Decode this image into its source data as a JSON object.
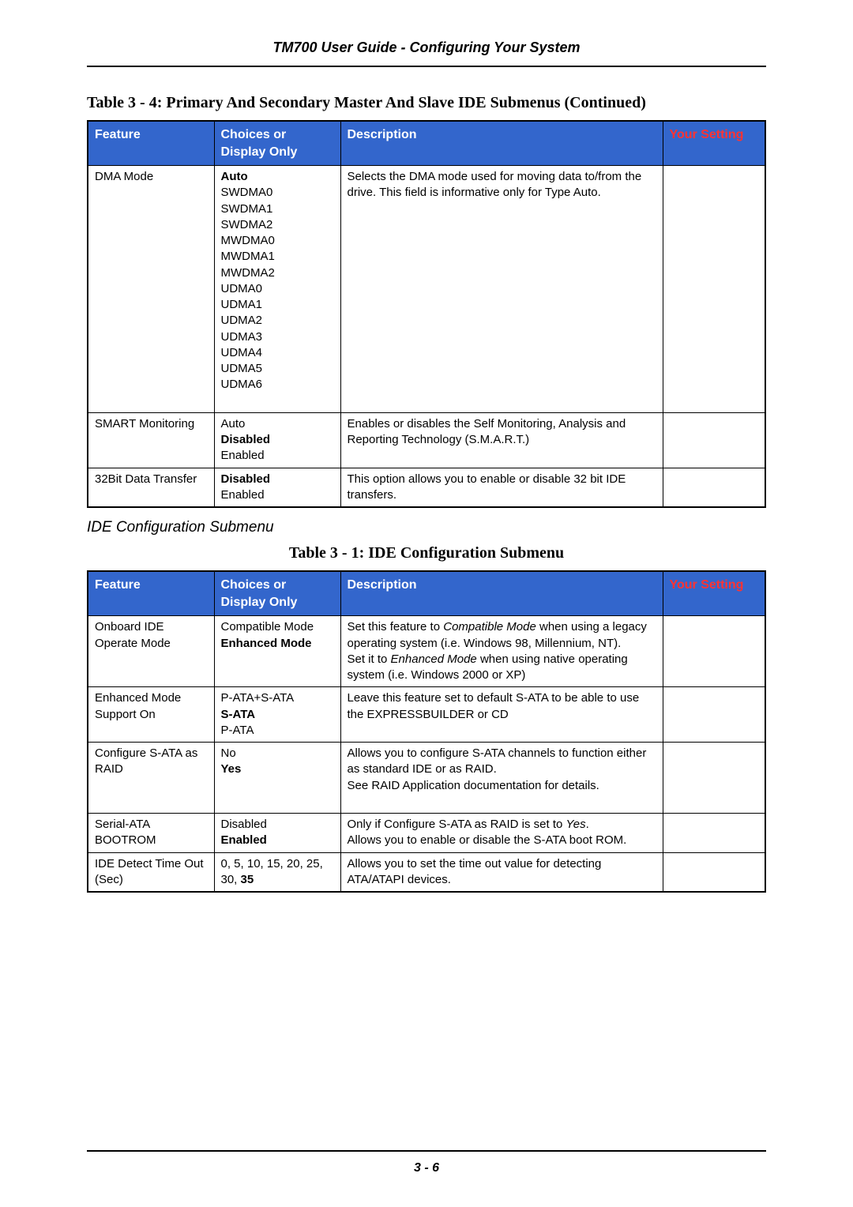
{
  "header": "TM700 User Guide - Configuring Your System",
  "table1": {
    "caption": "Table 3 - 4: Primary And Secondary Master And Slave IDE Submenus  (Continued)",
    "headers": {
      "feature": "Feature",
      "choices": "Choices or\nDisplay Only",
      "description": "Description",
      "setting": "Your Setting"
    },
    "rows": [
      {
        "feature": "DMA Mode",
        "choices_bold": "Auto",
        "choices_rest": "SWDMA0\nSWDMA1\nSWDMA2\nMWDMA0\nMWDMA1\nMWDMA2\nUDMA0\nUDMA1\nUDMA2\nUDMA3\nUDMA4\nUDMA5\nUDMA6",
        "description": "Selects the DMA mode used for moving data to/from the drive. This field is informative only for Type Auto.",
        "setting": ""
      },
      {
        "feature": "SMART Monitoring",
        "choices_pre": "Auto",
        "choices_bold": "Disabled",
        "choices_rest": "Enabled",
        "description": "Enables or disables the Self Monitoring, Analysis and Reporting Technology (S.M.A.R.T.)",
        "setting": ""
      },
      {
        "feature": "32Bit Data Transfer",
        "choices_bold": "Disabled",
        "choices_rest": "Enabled",
        "description": "This option allows you to enable or disable 32 bit IDE transfers.",
        "setting": ""
      }
    ]
  },
  "subsection": "IDE Configuration Submenu",
  "table2": {
    "caption": "Table 3 - 1: IDE Configuration Submenu",
    "headers": {
      "feature": "Feature",
      "choices": "Choices or\nDisplay Only",
      "description": "Description",
      "setting": "Your Setting"
    },
    "rows": [
      {
        "feature": "Onboard IDE Operate Mode",
        "choices_pre": "Compatible Mode",
        "choices_bold": "Enhanced Mode",
        "desc_pre": "Set this feature to ",
        "desc_it1": "Compatible Mode",
        "desc_mid1": " when using a legacy operating system (i.e. Windows 98, Millennium, NT).\nSet it to ",
        "desc_it2": "Enhanced Mode",
        "desc_mid2": " when using native operating system (i.e. Windows 2000 or XP)",
        "setting": ""
      },
      {
        "feature": "Enhanced Mode Support On",
        "choices_pre": "P-ATA+S-ATA",
        "choices_bold": "S-ATA",
        "choices_rest": "P-ATA",
        "description": "Leave this feature set to default S-ATA to be able to use the EXPRESSBUILDER or CD",
        "setting": ""
      },
      {
        "feature": "Configure S-ATA as RAID",
        "choices_pre": "No",
        "choices_bold": "Yes",
        "description": "Allows you to configure S-ATA channels to function either as standard IDE or as RAID.\nSee RAID Application documentation for details.",
        "setting": ""
      },
      {
        "feature": "Serial-ATA BOOTROM",
        "choices_pre": "Disabled",
        "choices_bold": "Enabled",
        "desc_pre": "Only if Configure S-ATA as RAID is set to ",
        "desc_it1": "Yes",
        "desc_mid1": ".\nAllows you to enable or disable the S-ATA boot ROM.",
        "setting": ""
      },
      {
        "feature": "IDE Detect Time Out (Sec)",
        "choices_pre": "0, 5, 10, 15, 20, 25, 30, ",
        "choices_bold_inline": "35",
        "description": "Allows you to set the time out value for detecting ATA/ATAPI devices.",
        "setting": ""
      }
    ]
  },
  "footer": "3 - 6"
}
